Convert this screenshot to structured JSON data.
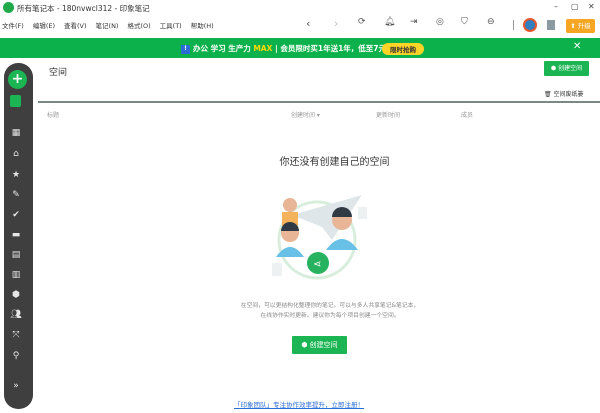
{
  "window": {
    "title": "所有笔记本 - 180nvwcl312 - 印象笔记",
    "minimize": "–",
    "maximize": "▢",
    "close": "✕"
  },
  "menu": [
    "文件(F)",
    "编辑(E)",
    "查看(V)",
    "笔记(N)",
    "格式(O)",
    "工具(T)",
    "帮助(H)"
  ],
  "toolbar": {
    "back": "‹",
    "forward": "›",
    "upgrade": "升级"
  },
  "banner": {
    "badge": "!",
    "text1": "办公 学习 生产力 ",
    "max": "MAX",
    "text2": " | 会员限时买1年送1年，低至7元/月",
    "promo": "限时抢购",
    "close": "✕",
    "bg": "#0db14b"
  },
  "sidebar": {
    "new": "+",
    "expand": "»",
    "icons": [
      "dashboard-icon",
      "home-icon",
      "star-icon",
      "pen-icon",
      "check-icon",
      "briefcase-icon",
      "note-icon",
      "notebook-icon",
      "space-icon",
      "people-icon",
      "expand-arrows-icon",
      "search-icon"
    ]
  },
  "main": {
    "title": "空间",
    "create_button": "创建空间",
    "trash": "空间废纸篓",
    "columns": [
      "标题",
      "创建时间 ▾",
      "更新时间",
      "成员"
    ],
    "empty_title": "你还没有创建自己的空间",
    "description_line1": "在空间，可以更结构化整理你的笔记，可以与多人共享笔记&笔记本，",
    "description_line2": "在线协作实时更新。建议你为每个项目创建一个空间。",
    "create_main": "创建空间",
    "link": "「印象团队」专注协作效率提升，立即注册！"
  },
  "colors": {
    "accent": "#1bb553",
    "sidebar": "#3f3f3f",
    "upgrade": "#f6a623"
  }
}
